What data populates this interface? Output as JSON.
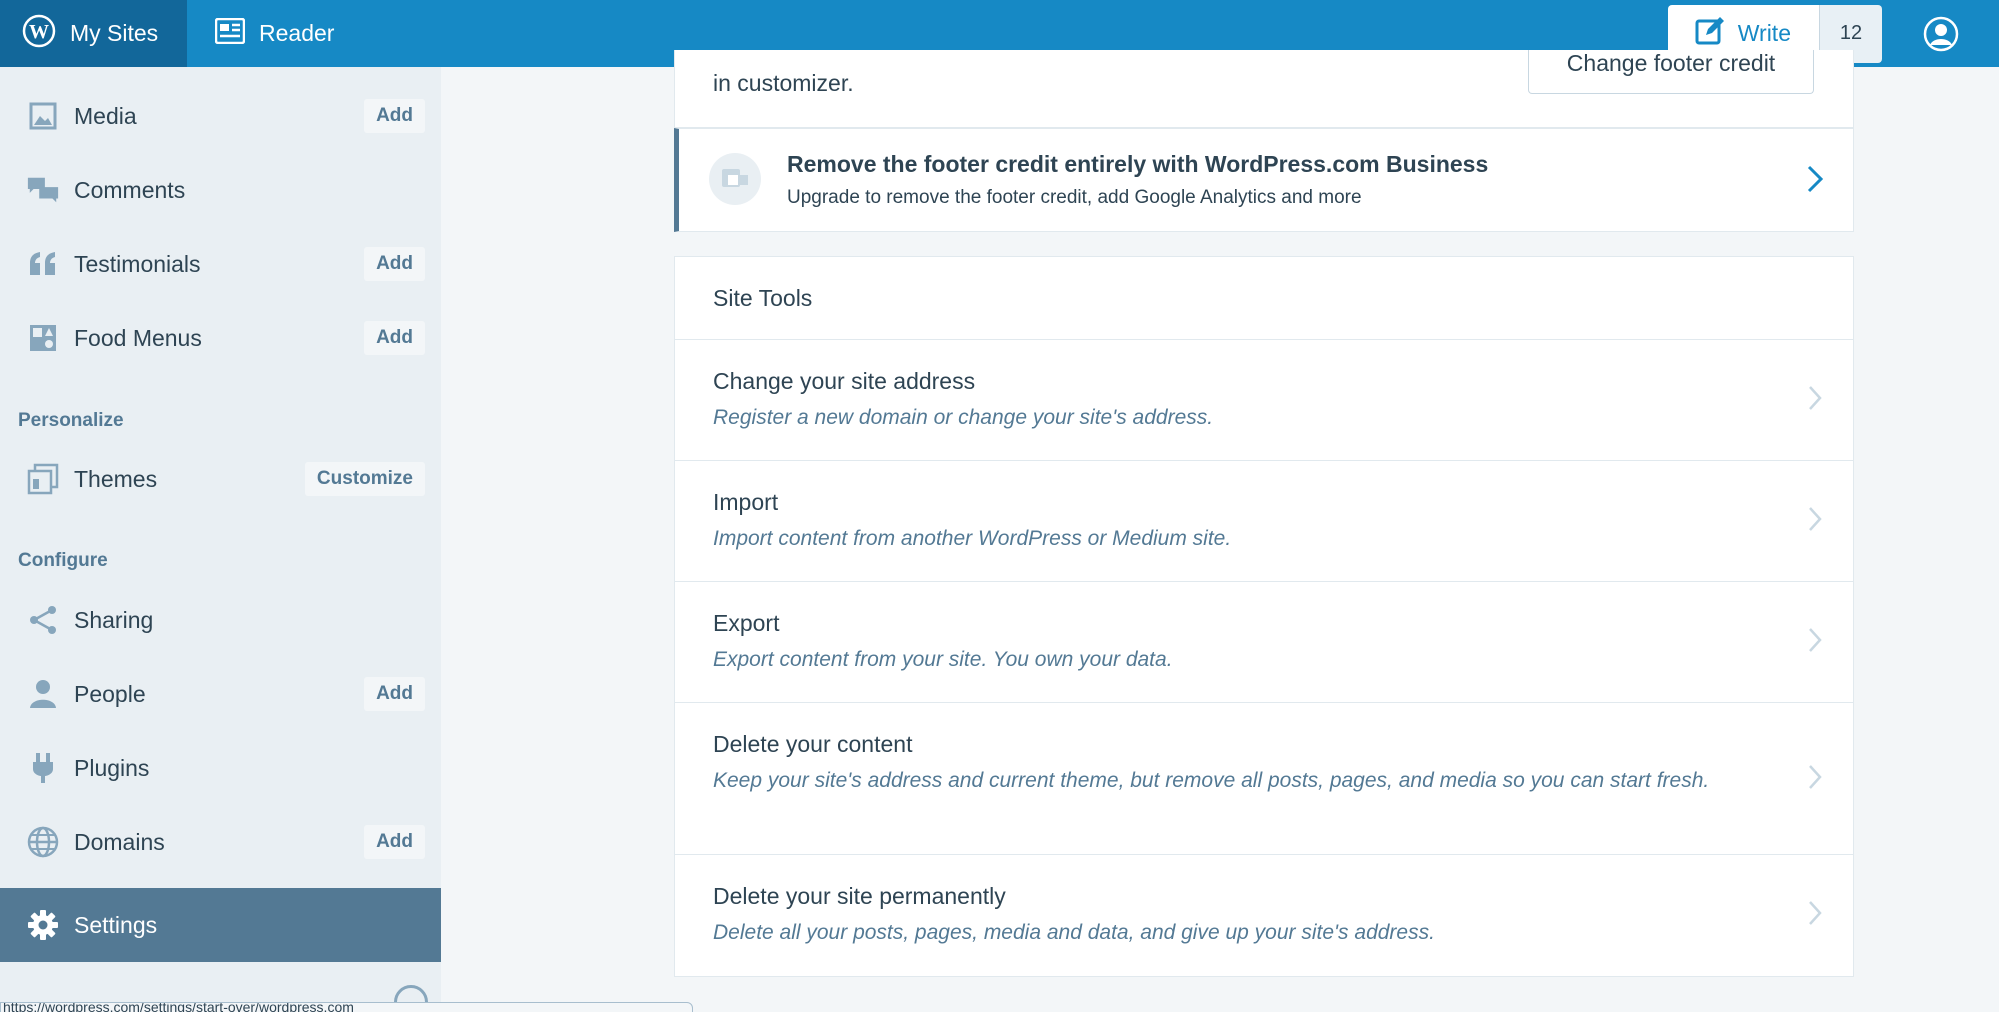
{
  "masterbar": {
    "my_sites": "My Sites",
    "reader": "Reader",
    "write": "Write",
    "notifications_count": "12"
  },
  "sidebar": {
    "items": [
      {
        "label": "Media",
        "action": "Add",
        "icon": "media-icon"
      },
      {
        "label": "Comments",
        "action": null,
        "icon": "comments-icon"
      },
      {
        "label": "Testimonials",
        "action": "Add",
        "icon": "quote-icon"
      },
      {
        "label": "Food Menus",
        "action": "Add",
        "icon": "food-menu-icon"
      }
    ],
    "personalize_heading": "Personalize",
    "personalize_items": [
      {
        "label": "Themes",
        "action": "Customize",
        "icon": "themes-icon"
      }
    ],
    "configure_heading": "Configure",
    "configure_items": [
      {
        "label": "Sharing",
        "action": null,
        "icon": "share-icon"
      },
      {
        "label": "People",
        "action": "Add",
        "icon": "person-icon"
      },
      {
        "label": "Plugins",
        "action": null,
        "icon": "plug-icon"
      },
      {
        "label": "Domains",
        "action": "Add",
        "icon": "globe-icon"
      },
      {
        "label": "Settings",
        "action": null,
        "icon": "gear-icon",
        "selected": true
      }
    ]
  },
  "footer_credit": {
    "text": "in customizer.",
    "button": "Change footer credit"
  },
  "upsell": {
    "title": "Remove the footer credit entirely with WordPress.com Business",
    "subtitle": "Upgrade to remove the footer credit, add Google Analytics and more"
  },
  "site_tools": {
    "header": "Site Tools",
    "rows": [
      {
        "title": "Change your site address",
        "description": "Register a new domain or change your site's address."
      },
      {
        "title": "Import",
        "description": "Import content from another WordPress or Medium site."
      },
      {
        "title": "Export",
        "description": "Export content from your site. You own your data."
      },
      {
        "title": "Delete your content",
        "description": "Keep your site's address and current theme, but remove all posts, pages, and media so you can start fresh."
      },
      {
        "title": "Delete your site permanently",
        "description": "Delete all your posts, pages, media and data, and give up your site's address."
      }
    ]
  },
  "status_url": "https://wordpress.com/settings/start-over/wordpress.com",
  "colors": {
    "masterbar": "#1689c5",
    "masterbar_active": "#12679a",
    "sidebar_bg": "#e9eff3",
    "sidebar_selected": "#537994",
    "text": "#2e4453",
    "secondary_text": "#537994"
  }
}
